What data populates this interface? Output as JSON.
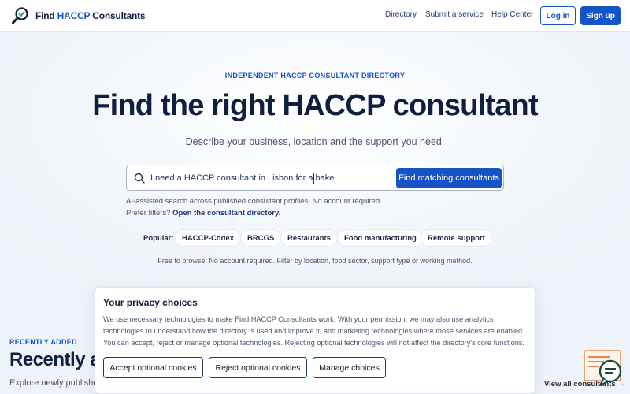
{
  "brand": {
    "name_part1": "Find ",
    "name_accent": "HACCP",
    "name_part2": " Consultants",
    "accent_color": "#1553c7"
  },
  "nav": {
    "links": [
      "Directory",
      "Submit a service",
      "Help Center"
    ],
    "login": "Log in",
    "signup": "Sign up"
  },
  "hero": {
    "eyebrow": "INDEPENDENT HACCP CONSULTANT DIRECTORY",
    "title": "Find the right HACCP consultant",
    "subtitle": "Describe your business, location and the support you need.",
    "search_value": "I need a HACCP consultant in Lisbon for a bake",
    "search_button": "Find matching consultants",
    "help_line1": "AI-assisted search across published consultant profiles. No account required.",
    "help_line2_prefix": "Prefer filters? ",
    "help_line2_link": "Open the consultant directory.",
    "popular_label": "Popular:",
    "chips": [
      "HACCP-Codex",
      "BRCGS",
      "Restaurants",
      "Food manufacturing",
      "Remote support"
    ],
    "free_line": "Free to browse. No account required. Filter by location, food sector, support type or working method."
  },
  "recent": {
    "eyebrow": "RECENTLY ADDED",
    "title_visible": "Recently ad",
    "subtitle_visible": "Explore newly published",
    "view_all": "View all consultants →"
  },
  "cookie": {
    "title": "Your privacy choices",
    "text": "We use necessary technologies to make Find HACCP Consultants work. With your permission, we may also use analytics technologies to understand how the directory is used and improve it, and marketing technologies where those services are enabled. You can accept, reject or manage optional technologies. Rejecting optional technologies will not affect the directory's core functions.",
    "accept": "Accept optional cookies",
    "reject": "Reject optional cookies",
    "manage": "Manage choices"
  },
  "icons": {
    "logo": "magnifier-logo-icon",
    "search": "search-icon",
    "chat": "chat-widget-icon"
  }
}
